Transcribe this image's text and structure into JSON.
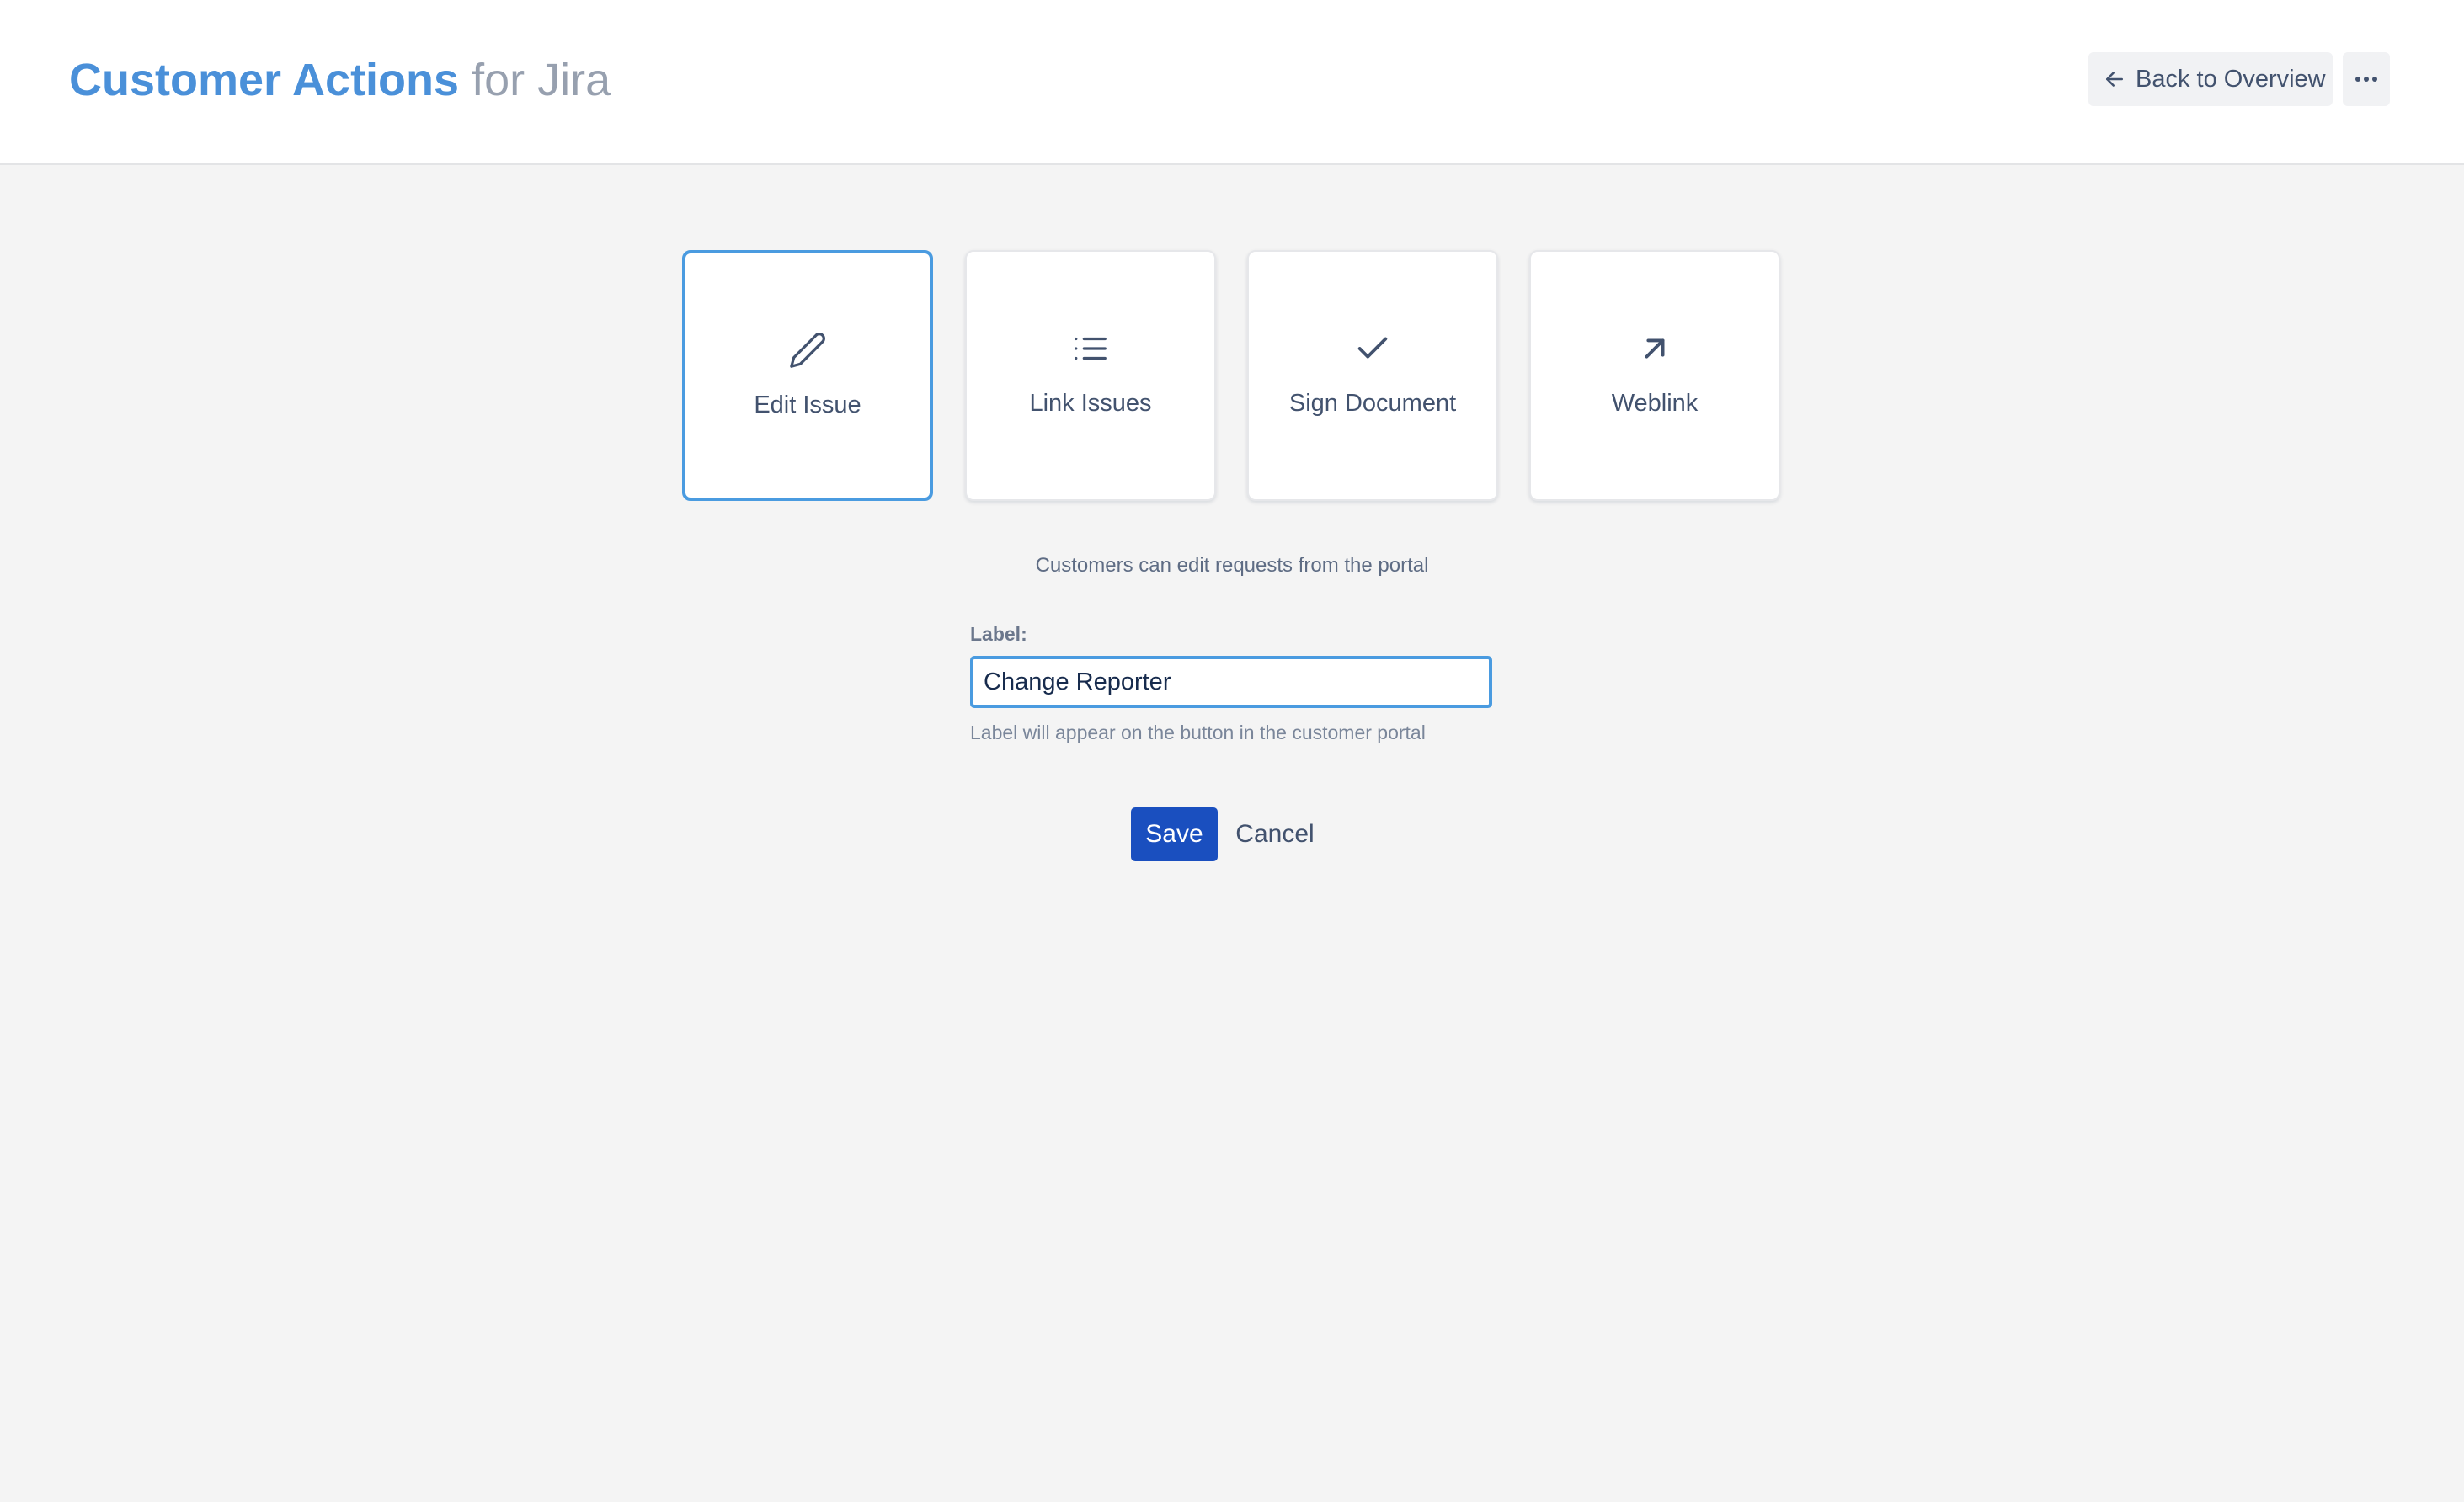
{
  "header": {
    "brand": "Customer Actions",
    "brand_suffix": "for Jira",
    "back_label": "Back to Overview",
    "back_icon": "arrow-left-icon",
    "more_icon": "more-horizontal-icon"
  },
  "action_types": [
    {
      "label": "Edit Issue",
      "icon": "pencil-icon",
      "selected": true
    },
    {
      "label": "Link Issues",
      "icon": "list-icon",
      "selected": false
    },
    {
      "label": "Sign Document",
      "icon": "checkmark-icon",
      "selected": false
    },
    {
      "label": "Weblink",
      "icon": "arrow-up-right-icon",
      "selected": false
    }
  ],
  "form": {
    "description": "Customers can edit requests from the portal",
    "label_title": "Label:",
    "label_value": "Change Reporter",
    "label_help": "Label will appear on the button in the customer portal",
    "save_label": "Save",
    "cancel_label": "Cancel"
  },
  "colors": {
    "brand": "#4a90d9",
    "selected_border": "#4a9be0",
    "primary_button": "#1a4fbf",
    "page_background": "#f4f4f4"
  }
}
